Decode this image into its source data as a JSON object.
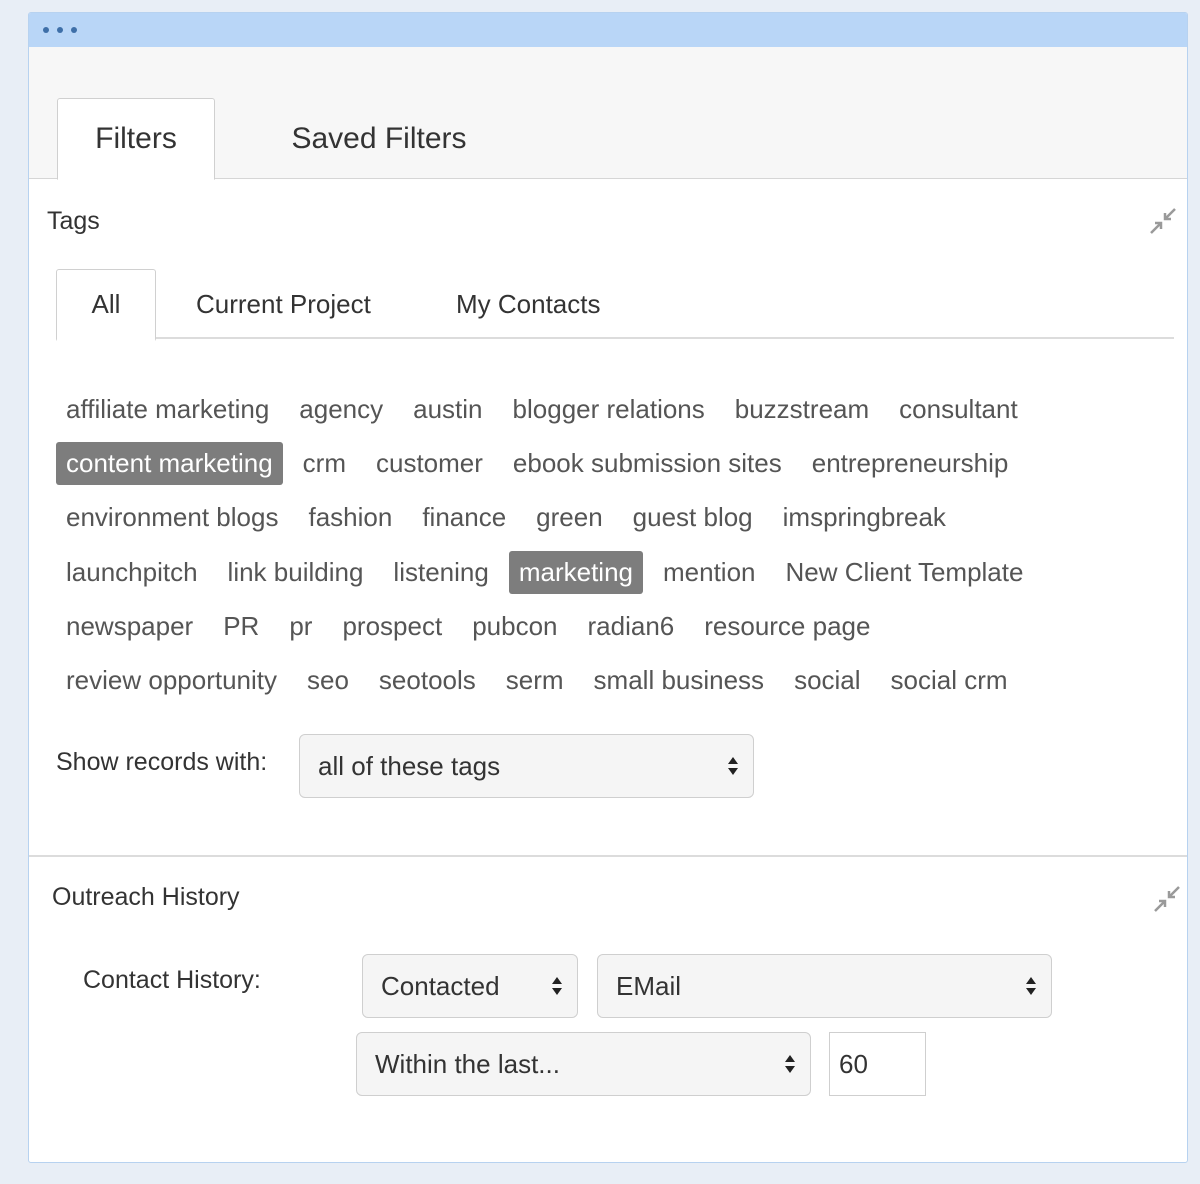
{
  "tabs": {
    "filters": "Filters",
    "saved_filters": "Saved Filters"
  },
  "tags_section": {
    "title": "Tags",
    "subtabs": {
      "all": "All",
      "current_project": "Current Project",
      "my_contacts": "My Contacts"
    },
    "rows": [
      [
        "affiliate marketing",
        "agency",
        "austin",
        "blogger relations",
        "buzzstream",
        "consultant"
      ],
      [
        "content marketing",
        "crm",
        "customer",
        "ebook submission sites",
        "entrepreneurship"
      ],
      [
        "environment blogs",
        "fashion",
        "finance",
        "green",
        "guest blog",
        "imspringbreak"
      ],
      [
        "launchpitch",
        "link building",
        "listening",
        "marketing",
        "mention",
        "New Client Template"
      ],
      [
        "newspaper",
        "PR",
        "pr",
        "prospect",
        "pubcon",
        "radian6",
        "resource page"
      ],
      [
        "review opportunity",
        "seo",
        "seotools",
        "serm",
        "small business",
        "social",
        "social crm"
      ]
    ],
    "selected": [
      "content marketing",
      "marketing"
    ],
    "show_records_label": "Show records with:",
    "show_records_value": "all of these tags"
  },
  "outreach_section": {
    "title": "Outreach History",
    "contact_history_label": "Contact History:",
    "status_value": "Contacted",
    "channel_value": "EMail",
    "time_value": "Within the last...",
    "days_value": "60"
  },
  "colors": {
    "titlebar": "#b9d6f7",
    "selected_tag": "#7d7d7d",
    "window_border": "#b7d2f0"
  }
}
